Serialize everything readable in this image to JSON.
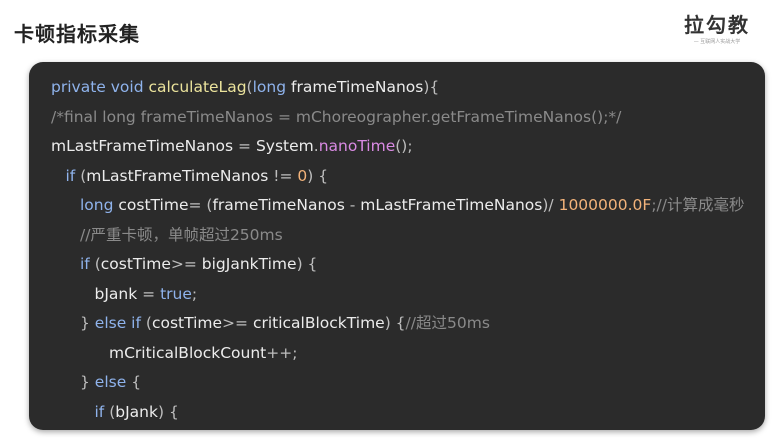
{
  "slide": {
    "title": "卡顿指标采集"
  },
  "logo": {
    "text": "拉勾教",
    "tagline": "— 互联网人实战大学"
  },
  "colors": {
    "panel_bg": "#2b2b2b",
    "keyword": "#8fb3ec",
    "function": "#ebe39c",
    "method": "#d98ae3",
    "number": "#f3b37a",
    "comment": "#8a8a8a",
    "identifier": "#ececec"
  },
  "code_lines": [
    {
      "indent": 0,
      "tokens": [
        {
          "t": "private ",
          "c": "kw"
        },
        {
          "t": "void ",
          "c": "kw"
        },
        {
          "t": "calculateLag",
          "c": "fn"
        },
        {
          "t": "(",
          "c": "op"
        },
        {
          "t": "long ",
          "c": "kw"
        },
        {
          "t": "frameTimeNanos",
          "c": "id"
        },
        {
          "t": "){",
          "c": "op"
        }
      ]
    },
    {
      "indent": 0,
      "tokens": [
        {
          "t": "/*final long frameTimeNanos = mChoreographer.getFrameTimeNanos();*/",
          "c": "cm"
        }
      ]
    },
    {
      "indent": 0,
      "tokens": [
        {
          "t": "mLastFrameTimeNanos",
          "c": "id"
        },
        {
          "t": " = ",
          "c": "op"
        },
        {
          "t": "System",
          "c": "id"
        },
        {
          "t": ".",
          "c": "op"
        },
        {
          "t": "nanoTime",
          "c": "mt"
        },
        {
          "t": "();",
          "c": "op"
        }
      ]
    },
    {
      "indent": 1,
      "tokens": [
        {
          "t": "if ",
          "c": "kw"
        },
        {
          "t": "(",
          "c": "op"
        },
        {
          "t": "mLastFrameTimeNanos",
          "c": "id"
        },
        {
          "t": " != ",
          "c": "op"
        },
        {
          "t": "0",
          "c": "num"
        },
        {
          "t": ") {",
          "c": "op"
        }
      ]
    },
    {
      "indent": 2,
      "tokens": [
        {
          "t": "long ",
          "c": "kw"
        },
        {
          "t": "costTime",
          "c": "id"
        },
        {
          "t": "= (",
          "c": "op"
        },
        {
          "t": "frameTimeNanos",
          "c": "id"
        },
        {
          "t": " - ",
          "c": "op"
        },
        {
          "t": "mLastFrameTimeNanos",
          "c": "id"
        },
        {
          "t": ")/ ",
          "c": "op"
        },
        {
          "t": "1000000.0F",
          "c": "num"
        },
        {
          "t": ";//计算成毫秒",
          "c": "cm"
        }
      ]
    },
    {
      "indent": 2,
      "tokens": [
        {
          "t": "//严重卡顿，单帧超过250ms",
          "c": "cm"
        }
      ]
    },
    {
      "indent": 2,
      "tokens": [
        {
          "t": "if ",
          "c": "kw"
        },
        {
          "t": "(",
          "c": "op"
        },
        {
          "t": "costTime",
          "c": "id"
        },
        {
          "t": ">= ",
          "c": "op"
        },
        {
          "t": "bigJankTime",
          "c": "id"
        },
        {
          "t": ") {",
          "c": "op"
        }
      ]
    },
    {
      "indent": 3,
      "tokens": [
        {
          "t": "bJank",
          "c": "id"
        },
        {
          "t": " = ",
          "c": "op"
        },
        {
          "t": "true",
          "c": "kw"
        },
        {
          "t": ";",
          "c": "op"
        }
      ]
    },
    {
      "indent": 2,
      "tokens": [
        {
          "t": "} ",
          "c": "op"
        },
        {
          "t": "else if ",
          "c": "kw"
        },
        {
          "t": "(",
          "c": "op"
        },
        {
          "t": "costTime",
          "c": "id"
        },
        {
          "t": ">= ",
          "c": "op"
        },
        {
          "t": "criticalBlockTime",
          "c": "id"
        },
        {
          "t": ") {",
          "c": "op"
        },
        {
          "t": "//超过50ms",
          "c": "cm"
        }
      ]
    },
    {
      "indent": 4,
      "tokens": [
        {
          "t": "mCriticalBlockCount",
          "c": "id"
        },
        {
          "t": "++;",
          "c": "op"
        }
      ]
    },
    {
      "indent": 2,
      "tokens": [
        {
          "t": "} ",
          "c": "op"
        },
        {
          "t": "else ",
          "c": "kw"
        },
        {
          "t": "{",
          "c": "op"
        }
      ]
    },
    {
      "indent": 3,
      "tokens": [
        {
          "t": "if ",
          "c": "kw"
        },
        {
          "t": "(",
          "c": "op"
        },
        {
          "t": "bJank",
          "c": "id"
        },
        {
          "t": ") {",
          "c": "op"
        }
      ]
    }
  ]
}
